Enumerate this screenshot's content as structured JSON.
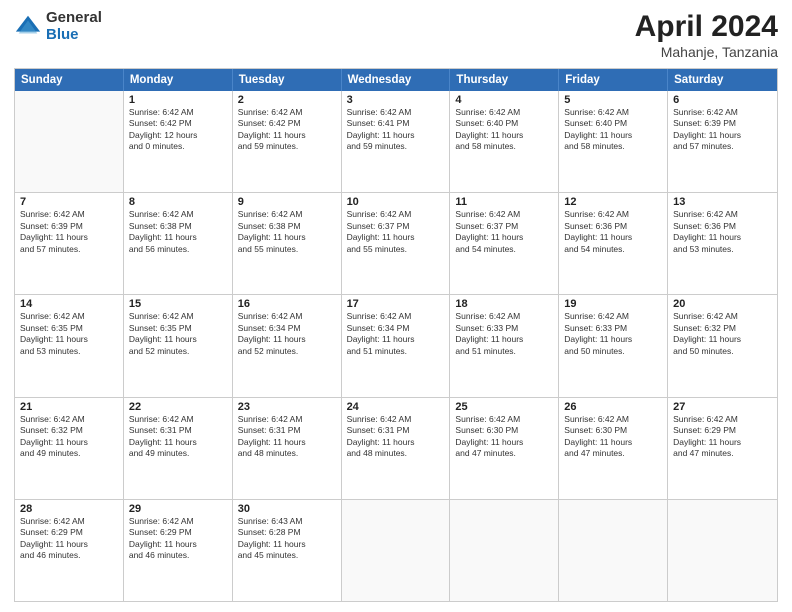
{
  "logo": {
    "general": "General",
    "blue": "Blue"
  },
  "title": "April 2024",
  "subtitle": "Mahanje, Tanzania",
  "headers": [
    "Sunday",
    "Monday",
    "Tuesday",
    "Wednesday",
    "Thursday",
    "Friday",
    "Saturday"
  ],
  "weeks": [
    [
      {
        "day": "",
        "info": ""
      },
      {
        "day": "1",
        "info": "Sunrise: 6:42 AM\nSunset: 6:42 PM\nDaylight: 12 hours\nand 0 minutes."
      },
      {
        "day": "2",
        "info": "Sunrise: 6:42 AM\nSunset: 6:42 PM\nDaylight: 11 hours\nand 59 minutes."
      },
      {
        "day": "3",
        "info": "Sunrise: 6:42 AM\nSunset: 6:41 PM\nDaylight: 11 hours\nand 59 minutes."
      },
      {
        "day": "4",
        "info": "Sunrise: 6:42 AM\nSunset: 6:40 PM\nDaylight: 11 hours\nand 58 minutes."
      },
      {
        "day": "5",
        "info": "Sunrise: 6:42 AM\nSunset: 6:40 PM\nDaylight: 11 hours\nand 58 minutes."
      },
      {
        "day": "6",
        "info": "Sunrise: 6:42 AM\nSunset: 6:39 PM\nDaylight: 11 hours\nand 57 minutes."
      }
    ],
    [
      {
        "day": "7",
        "info": "Sunrise: 6:42 AM\nSunset: 6:39 PM\nDaylight: 11 hours\nand 57 minutes."
      },
      {
        "day": "8",
        "info": "Sunrise: 6:42 AM\nSunset: 6:38 PM\nDaylight: 11 hours\nand 56 minutes."
      },
      {
        "day": "9",
        "info": "Sunrise: 6:42 AM\nSunset: 6:38 PM\nDaylight: 11 hours\nand 55 minutes."
      },
      {
        "day": "10",
        "info": "Sunrise: 6:42 AM\nSunset: 6:37 PM\nDaylight: 11 hours\nand 55 minutes."
      },
      {
        "day": "11",
        "info": "Sunrise: 6:42 AM\nSunset: 6:37 PM\nDaylight: 11 hours\nand 54 minutes."
      },
      {
        "day": "12",
        "info": "Sunrise: 6:42 AM\nSunset: 6:36 PM\nDaylight: 11 hours\nand 54 minutes."
      },
      {
        "day": "13",
        "info": "Sunrise: 6:42 AM\nSunset: 6:36 PM\nDaylight: 11 hours\nand 53 minutes."
      }
    ],
    [
      {
        "day": "14",
        "info": "Sunrise: 6:42 AM\nSunset: 6:35 PM\nDaylight: 11 hours\nand 53 minutes."
      },
      {
        "day": "15",
        "info": "Sunrise: 6:42 AM\nSunset: 6:35 PM\nDaylight: 11 hours\nand 52 minutes."
      },
      {
        "day": "16",
        "info": "Sunrise: 6:42 AM\nSunset: 6:34 PM\nDaylight: 11 hours\nand 52 minutes."
      },
      {
        "day": "17",
        "info": "Sunrise: 6:42 AM\nSunset: 6:34 PM\nDaylight: 11 hours\nand 51 minutes."
      },
      {
        "day": "18",
        "info": "Sunrise: 6:42 AM\nSunset: 6:33 PM\nDaylight: 11 hours\nand 51 minutes."
      },
      {
        "day": "19",
        "info": "Sunrise: 6:42 AM\nSunset: 6:33 PM\nDaylight: 11 hours\nand 50 minutes."
      },
      {
        "day": "20",
        "info": "Sunrise: 6:42 AM\nSunset: 6:32 PM\nDaylight: 11 hours\nand 50 minutes."
      }
    ],
    [
      {
        "day": "21",
        "info": "Sunrise: 6:42 AM\nSunset: 6:32 PM\nDaylight: 11 hours\nand 49 minutes."
      },
      {
        "day": "22",
        "info": "Sunrise: 6:42 AM\nSunset: 6:31 PM\nDaylight: 11 hours\nand 49 minutes."
      },
      {
        "day": "23",
        "info": "Sunrise: 6:42 AM\nSunset: 6:31 PM\nDaylight: 11 hours\nand 48 minutes."
      },
      {
        "day": "24",
        "info": "Sunrise: 6:42 AM\nSunset: 6:31 PM\nDaylight: 11 hours\nand 48 minutes."
      },
      {
        "day": "25",
        "info": "Sunrise: 6:42 AM\nSunset: 6:30 PM\nDaylight: 11 hours\nand 47 minutes."
      },
      {
        "day": "26",
        "info": "Sunrise: 6:42 AM\nSunset: 6:30 PM\nDaylight: 11 hours\nand 47 minutes."
      },
      {
        "day": "27",
        "info": "Sunrise: 6:42 AM\nSunset: 6:29 PM\nDaylight: 11 hours\nand 47 minutes."
      }
    ],
    [
      {
        "day": "28",
        "info": "Sunrise: 6:42 AM\nSunset: 6:29 PM\nDaylight: 11 hours\nand 46 minutes."
      },
      {
        "day": "29",
        "info": "Sunrise: 6:42 AM\nSunset: 6:29 PM\nDaylight: 11 hours\nand 46 minutes."
      },
      {
        "day": "30",
        "info": "Sunrise: 6:43 AM\nSunset: 6:28 PM\nDaylight: 11 hours\nand 45 minutes."
      },
      {
        "day": "",
        "info": ""
      },
      {
        "day": "",
        "info": ""
      },
      {
        "day": "",
        "info": ""
      },
      {
        "day": "",
        "info": ""
      }
    ]
  ]
}
